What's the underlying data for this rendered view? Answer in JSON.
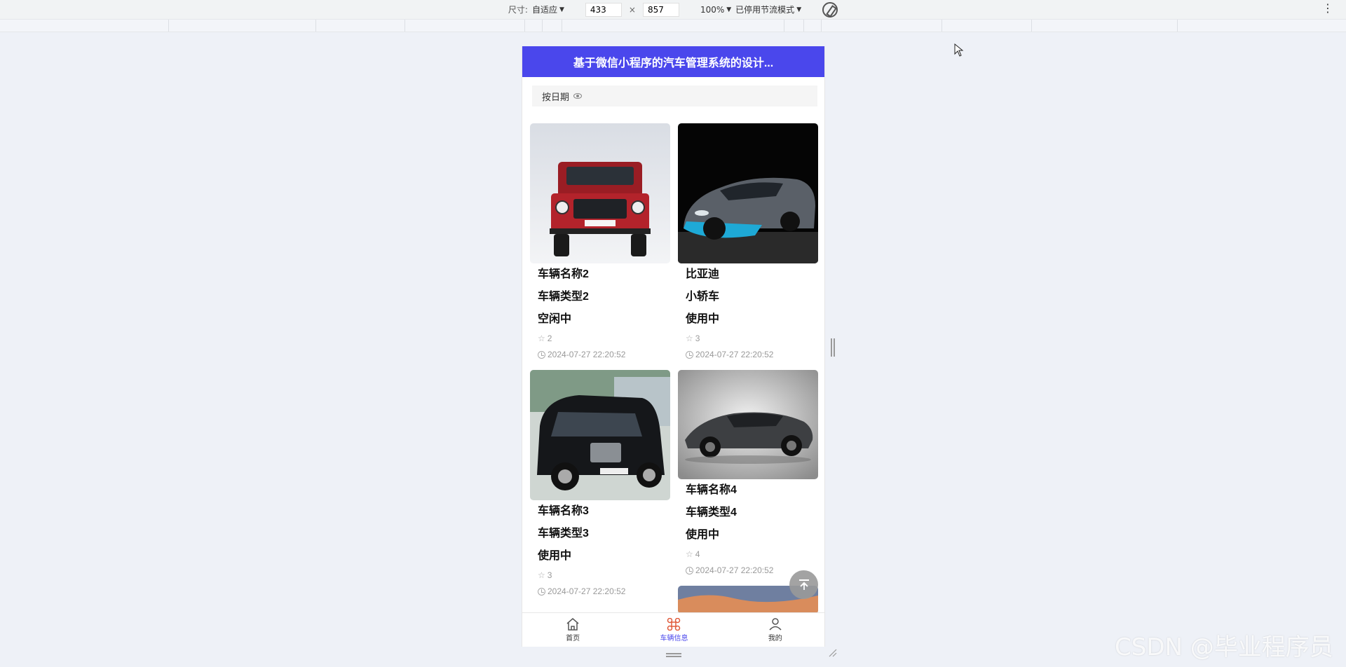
{
  "devtools": {
    "size_label": "尺寸:",
    "size_mode": "自适应",
    "width": "433",
    "times": "×",
    "height": "857",
    "zoom": "100%",
    "throttle": "已停用节流模式"
  },
  "app": {
    "title": "基于微信小程序的汽车管理系统的设计...",
    "sort_label": "按日期"
  },
  "cards_left": [
    {
      "name": "车辆名称2",
      "type": "车辆类型2",
      "status": "空闲中",
      "likes": "2",
      "date": "2024-07-27 22:20:52"
    },
    {
      "name": "车辆名称3",
      "type": "车辆类型3",
      "status": "使用中",
      "likes": "3",
      "date": "2024-07-27 22:20:52"
    }
  ],
  "cards_right": [
    {
      "name": "比亚迪",
      "type": "小轿车",
      "status": "使用中",
      "likes": "3",
      "date": "2024-07-27 22:20:52"
    },
    {
      "name": "车辆名称4",
      "type": "车辆类型4",
      "status": "使用中",
      "likes": "4",
      "date": "2024-07-27 22:20:52"
    }
  ],
  "tabbar": {
    "home": "首页",
    "vehicles": "车辆信息",
    "mine": "我的"
  },
  "watermark": "CSDN @毕业程序员",
  "colors": {
    "accent": "#4a47ec"
  }
}
